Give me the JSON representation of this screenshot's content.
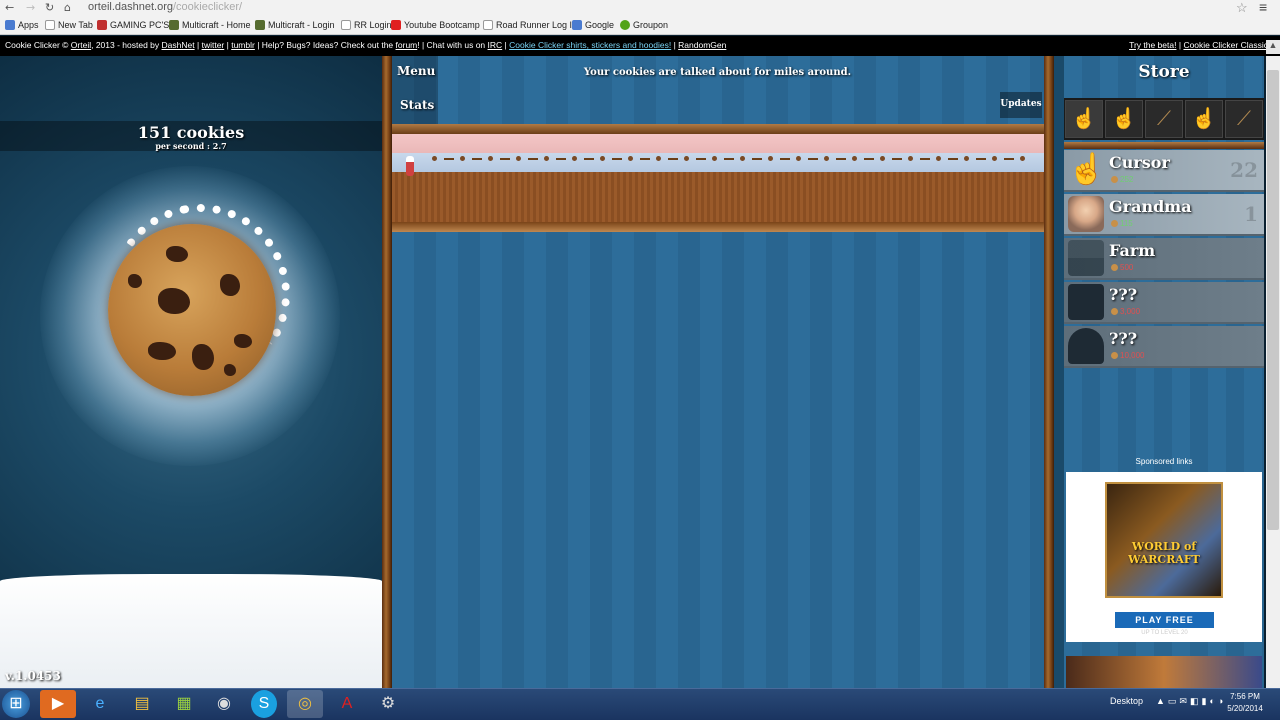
{
  "browser": {
    "url_host": "orteil.dashnet.org",
    "url_path": "/cookieclicker/",
    "bookmarks": [
      {
        "label": "Apps",
        "color": "#4a7bd0"
      },
      {
        "label": "New Tab",
        "color": "#ffffff"
      },
      {
        "label": "GAMING PC'S",
        "color": "#c03030"
      },
      {
        "label": "Multicraft - Home",
        "color": "#556b2f"
      },
      {
        "label": "Multicraft - Login",
        "color": "#556b2f"
      },
      {
        "label": "RR Login",
        "color": "#ffffff"
      },
      {
        "label": "Youtube Bootcamp",
        "color": "#e02020"
      },
      {
        "label": "Road Runner Log In",
        "color": "#ffffff"
      },
      {
        "label": "Google",
        "color": "#4a7bd0"
      },
      {
        "label": "Groupon",
        "color": "#53a318"
      }
    ]
  },
  "topbar": {
    "credit": "Cookie Clicker ©",
    "author": "Orteil",
    "year_hosted": ", 2013 - hosted by",
    "host": "DashNet",
    "sep1": "|",
    "twitter": "twitter",
    "sep2": "|",
    "tumblr": "tumblr",
    "help_text": "| Help? Bugs? Ideas? Check out the",
    "forum": "forum",
    "chat_text": "! | Chat with us on",
    "irc": "IRC",
    "sep3": "|",
    "shirts": "Cookie Clicker shirts, stickers and hoodies!",
    "sep4": "|",
    "randomgen": "RandomGen",
    "try_beta": "Try the beta!",
    "sep5": "|",
    "classic": "Cookie Clicker Classic"
  },
  "game": {
    "cookie_count": "151 cookies",
    "per_second": "per second : 2.7",
    "version": "v.1.0453",
    "menu": "Menu",
    "stats": "Stats",
    "updates": "Updates",
    "news": "Your cookies are talked about for miles around."
  },
  "store": {
    "title": "Store",
    "upgrades": [
      {
        "icon": "cursor-upgrade-icon",
        "glyph": "☝"
      },
      {
        "icon": "cursor-upgrade-icon",
        "glyph": "☝"
      },
      {
        "icon": "rolling-pin-upgrade-icon",
        "glyph": "⟋"
      },
      {
        "icon": "cursor-upgrade-icon",
        "glyph": "☝"
      },
      {
        "icon": "rolling-pin-upgrade-icon",
        "glyph": "⟋"
      }
    ],
    "products": [
      {
        "name": "Cursor",
        "price": "252",
        "owned": "22",
        "locked": false
      },
      {
        "name": "Grandma",
        "price": "115",
        "owned": "1",
        "locked": false
      },
      {
        "name": "Farm",
        "price": "500",
        "owned": "",
        "locked": true
      },
      {
        "name": "???",
        "price": "3,000",
        "owned": "",
        "locked": true
      },
      {
        "name": "???",
        "price": "10,000",
        "owned": "",
        "locked": true
      }
    ],
    "sponsored": "Sponsored links",
    "ad_title": "WORLD of WARCRAFT",
    "ad_button": "PLAY FREE",
    "ad_sub": "UP TO LEVEL 20"
  },
  "taskbar": {
    "desktop_label": "Desktop",
    "time": "7:56 PM",
    "date": "5/20/2014"
  },
  "colors": {
    "background_blue": "#2d6d9a",
    "wood": "#9a5a2a",
    "price_green": "#6fd06f",
    "price_red": "#e05050"
  }
}
